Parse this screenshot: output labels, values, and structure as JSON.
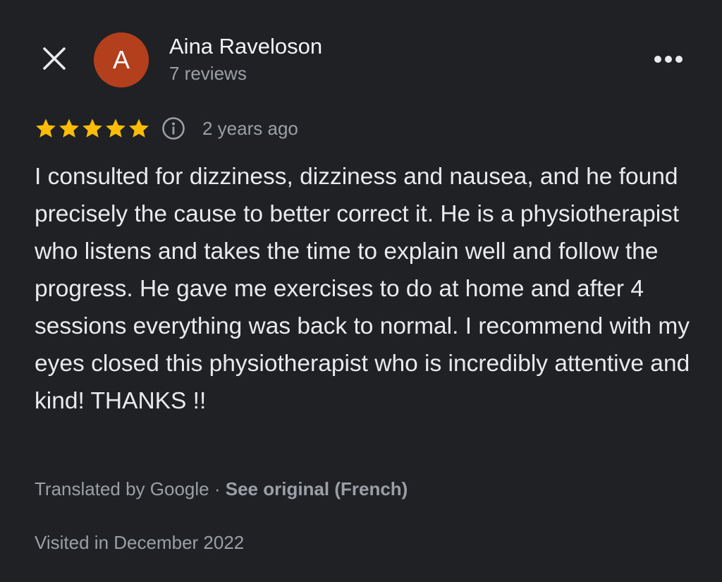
{
  "header": {
    "close_icon": "close-icon",
    "avatar_letter": "A",
    "avatar_color": "#b33f1d",
    "reviewer_name": "Aina Raveloson",
    "review_count": "7 reviews",
    "more_icon": "more-horizontal-icon"
  },
  "review": {
    "rating": 5,
    "rating_max": 5,
    "star_color": "#fbbc04",
    "info_icon": "info-icon",
    "date": "2 years ago",
    "text": "I consulted for dizziness, dizziness and nausea, and he found precisely the cause to better correct it. He is a physiotherapist who listens and takes the time to explain well and follow the progress. He gave me exercises to do at home and after 4 sessions everything was back to normal. I recommend with my eyes closed this physiotherapist who is incredibly attentive and kind! THANKS !!",
    "translated_label": "Translated by Google",
    "separator": " · ",
    "see_original_label": "See original (French)",
    "visited": "Visited in December 2022"
  }
}
